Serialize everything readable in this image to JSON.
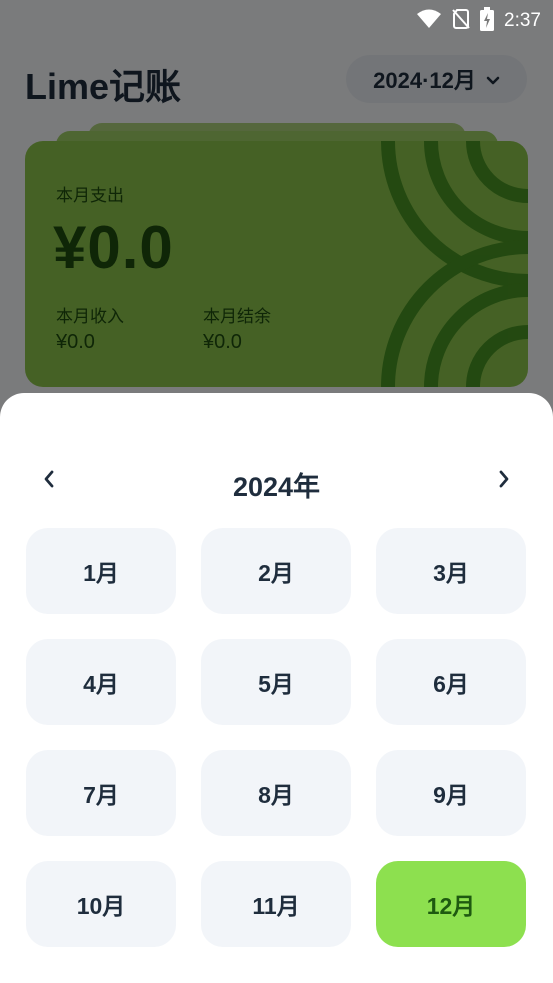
{
  "status_bar": {
    "time": "2:37"
  },
  "header": {
    "title": "Lime记账",
    "month_selector": "2024·12月"
  },
  "card": {
    "expense_label": "本月支出",
    "expense_value": "¥0.0",
    "income_label": "本月收入",
    "income_value": "¥0.0",
    "balance_label": "本月结余",
    "balance_value": "¥0.0"
  },
  "picker": {
    "year": "2024年",
    "months": [
      "1月",
      "2月",
      "3月",
      "4月",
      "5月",
      "6月",
      "7月",
      "8月",
      "9月",
      "10月",
      "11月",
      "12月"
    ],
    "selected": "12月"
  },
  "colors": {
    "accent": "#8de04f",
    "card": "#8bc34a",
    "text": "#1f2d3d"
  },
  "icons": [
    "wifi-icon",
    "no-sim-icon",
    "battery-icon",
    "chevron-down-icon",
    "chevron-left-icon",
    "chevron-right-icon"
  ]
}
